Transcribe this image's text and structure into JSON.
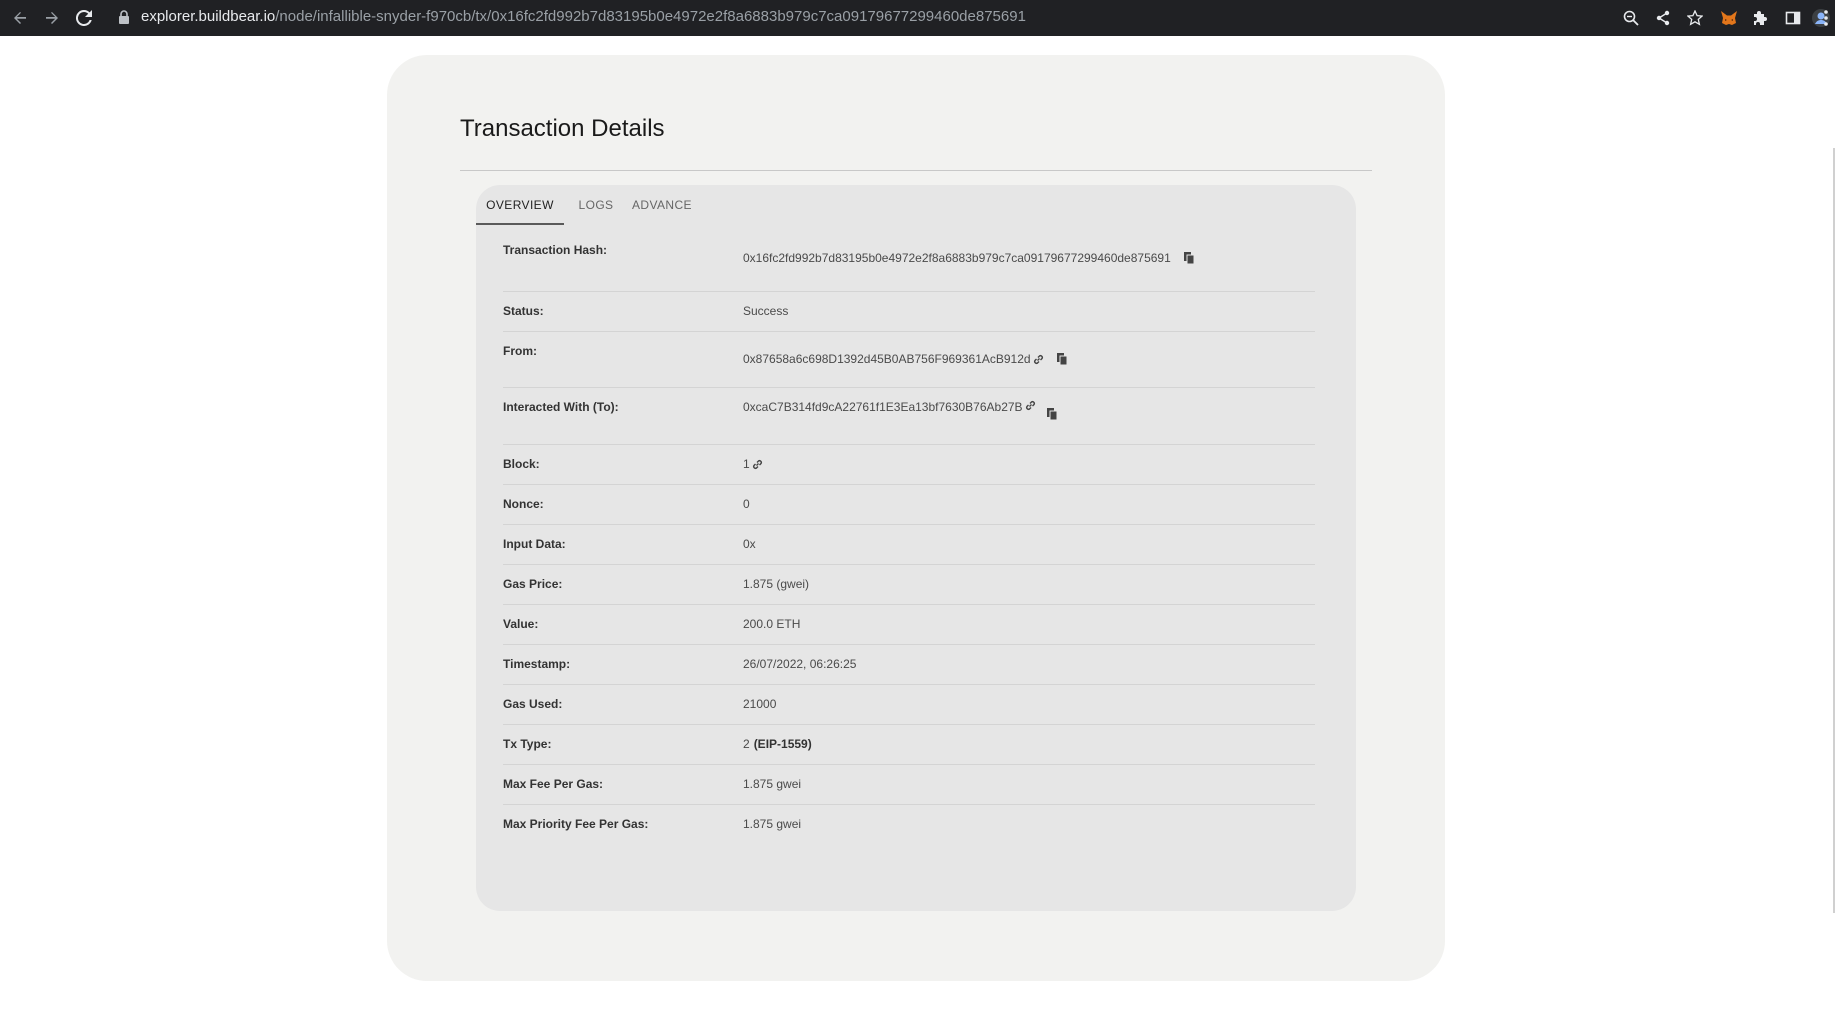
{
  "browser": {
    "url_host": "explorer.buildbear.io",
    "url_path": "/node/infallible-snyder-f970cb/tx/0x16fc2fd992b7d83195b0e4972e2f8a6883b979c7ca09179677299460de875691"
  },
  "page": {
    "title": "Transaction Details",
    "tabs": [
      {
        "label": "OVERVIEW",
        "active": true
      },
      {
        "label": "LOGS",
        "active": false
      },
      {
        "label": "ADVANCE",
        "active": false
      }
    ]
  },
  "details": {
    "tx_hash_label": "Transaction Hash:",
    "tx_hash_value": "0x16fc2fd992b7d83195b0e4972e2f8a6883b979c7ca09179677299460de875691",
    "status_label": "Status:",
    "status_value": "Success",
    "from_label": "From:",
    "from_value": "0x87658a6c698D1392d45B0AB756F969361AcB912d",
    "to_label": "Interacted With (To):",
    "to_value": "0xcaC7B314fd9cA22761f1E3Ea13bf7630B76Ab27B",
    "block_label": "Block:",
    "block_value": "1",
    "nonce_label": "Nonce:",
    "nonce_value": "0",
    "input_label": "Input Data:",
    "input_value": "0x",
    "gas_price_label": "Gas Price:",
    "gas_price_value": "1.875 (gwei)",
    "value_label": "Value:",
    "value_value": "200.0 ETH",
    "timestamp_label": "Timestamp:",
    "timestamp_value": "26/07/2022, 06:26:25",
    "gas_used_label": "Gas Used:",
    "gas_used_value": "21000",
    "tx_type_label": "Tx Type:",
    "tx_type_value": "2",
    "tx_type_name": "(EIP-1559)",
    "max_fee_label": "Max Fee Per Gas:",
    "max_fee_value": "1.875 gwei",
    "max_priority_label": "Max Priority Fee Per Gas:",
    "max_priority_value": "1.875 gwei"
  },
  "icons": {
    "copy": "copy-icon",
    "link": "link-icon"
  }
}
